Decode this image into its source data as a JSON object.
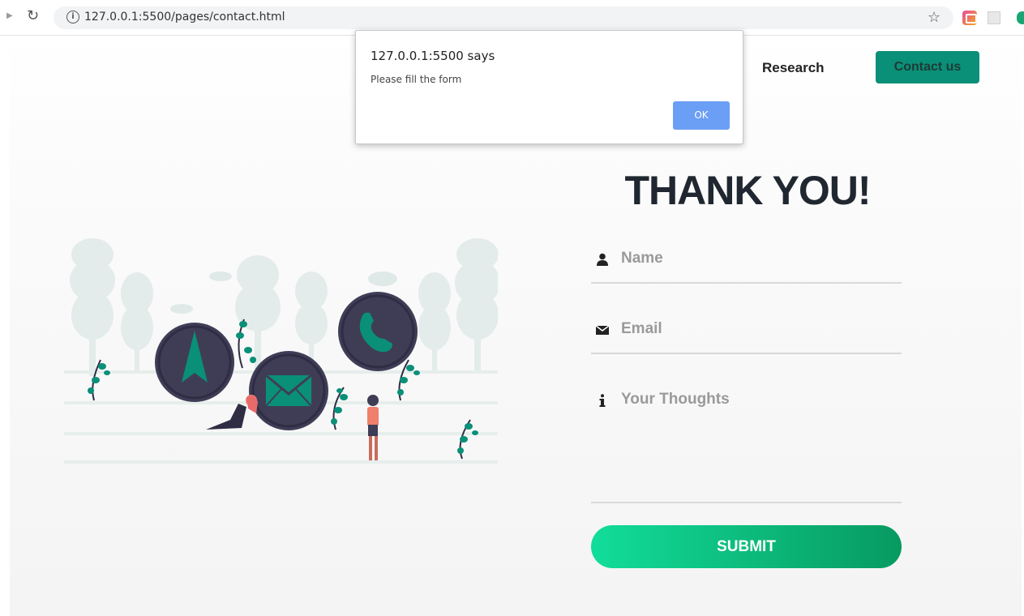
{
  "browser": {
    "url": "127.0.0.1:5500/pages/contact.html"
  },
  "nav": {
    "research_label": "Research",
    "contact_label": "Contact us"
  },
  "hero": {
    "title": "THANK YOU!"
  },
  "form": {
    "name_placeholder": "Name",
    "email_placeholder": "Email",
    "thoughts_placeholder": "Your Thoughts",
    "submit_label": "SUBMIT"
  },
  "dialog": {
    "title": "127.0.0.1:5500 says",
    "message": "Please fill the form",
    "ok_label": "OK"
  },
  "colors": {
    "accent": "#0a8f78",
    "submit_start": "#12dd9a",
    "submit_end": "#079a60",
    "icon_circle": "#3f3d56",
    "tree": "#e3ecea",
    "dialog_button": "#6b9ef5"
  },
  "icons": {
    "name": "user-icon",
    "email": "envelope-icon",
    "thoughts": "info-icon"
  }
}
